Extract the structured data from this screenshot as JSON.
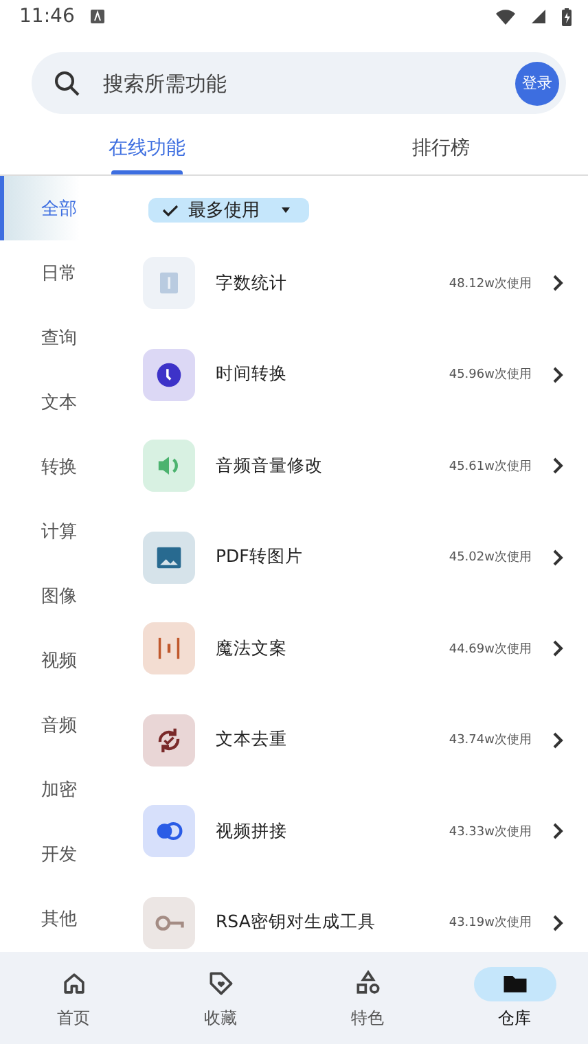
{
  "status_bar": {
    "time": "11:46"
  },
  "search": {
    "placeholder": "搜索所需功能",
    "login_label": "登录"
  },
  "tabs": [
    {
      "label": "在线功能",
      "selected": true
    },
    {
      "label": "排行榜",
      "selected": false
    }
  ],
  "categories": [
    {
      "label": "全部",
      "selected": true
    },
    {
      "label": "日常",
      "selected": false
    },
    {
      "label": "查询",
      "selected": false
    },
    {
      "label": "文本",
      "selected": false
    },
    {
      "label": "转换",
      "selected": false
    },
    {
      "label": "计算",
      "selected": false
    },
    {
      "label": "图像",
      "selected": false
    },
    {
      "label": "视频",
      "selected": false
    },
    {
      "label": "音频",
      "selected": false
    },
    {
      "label": "加密",
      "selected": false
    },
    {
      "label": "开发",
      "selected": false
    },
    {
      "label": "其他",
      "selected": false
    }
  ],
  "sort_chip": {
    "label": "最多使用",
    "checked": true
  },
  "tools": [
    {
      "name": "字数统计",
      "usage": "48.12w次使用"
    },
    {
      "name": "时间转换",
      "usage": "45.96w次使用"
    },
    {
      "name": "音频音量修改",
      "usage": "45.61w次使用"
    },
    {
      "name": "PDF转图片",
      "usage": "45.02w次使用"
    },
    {
      "name": "魔法文案",
      "usage": "44.69w次使用"
    },
    {
      "name": "文本去重",
      "usage": "43.74w次使用"
    },
    {
      "name": "视频拼接",
      "usage": "43.33w次使用"
    },
    {
      "name": "RSA密钥对生成工具",
      "usage": "43.19w次使用"
    }
  ],
  "bottom_nav": [
    {
      "label": "首页",
      "selected": false
    },
    {
      "label": "收藏",
      "selected": false
    },
    {
      "label": "特色",
      "selected": false
    },
    {
      "label": "仓库",
      "selected": true
    }
  ]
}
